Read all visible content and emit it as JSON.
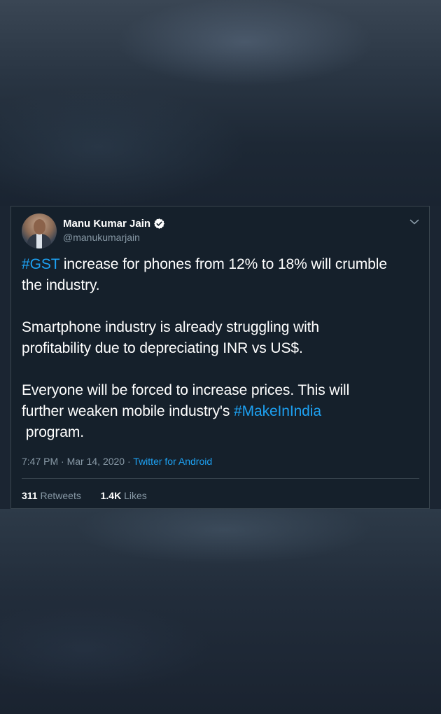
{
  "tweet": {
    "author": {
      "name": "Manu Kumar Jain",
      "handle": "@manukumarjain",
      "verified": true
    },
    "text": {
      "line1_hashtag": "#GST",
      "line1_rest": " increase for phones from 12% to 18% will crumble",
      "line2": "the industry.",
      "line3": "Smartphone industry is already struggling with",
      "line4": "profitability due to depreciating INR vs US$.",
      "line5": "Everyone will be forced to increase prices. This will",
      "line6_prefix": "further weaken mobile industry's ",
      "line6_hashtag": "#MakeInIndia",
      "line7": " program."
    },
    "meta": {
      "time": "7:47 PM",
      "sep1": " · ",
      "date": "Mar 14, 2020",
      "sep2": " · ",
      "source": "Twitter for Android"
    },
    "stats": {
      "retweets_count": "311",
      "retweets_label": " Retweets",
      "likes_count": "1.4K",
      "likes_label": " Likes"
    }
  },
  "colors": {
    "card_background": "#15202b",
    "link": "#1da1f2",
    "muted_text": "#8899a6",
    "border": "#38444d"
  },
  "icons": {
    "verified": "verified-badge-icon",
    "menu": "chevron-down-icon"
  }
}
